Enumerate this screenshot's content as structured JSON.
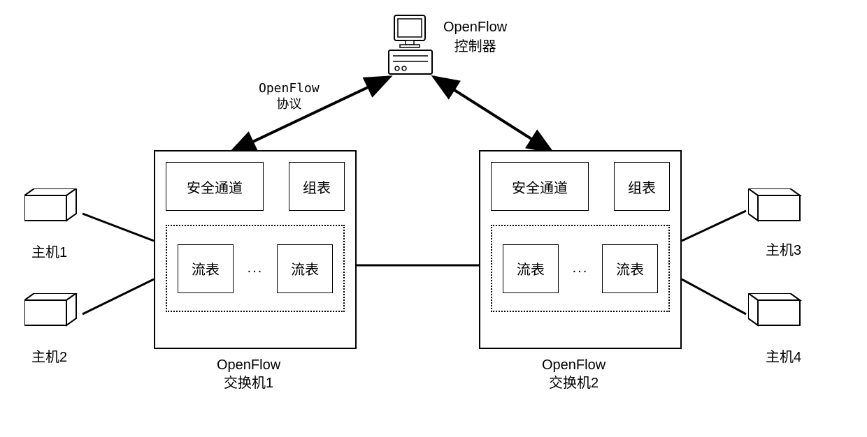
{
  "controller": {
    "title_line1": "OpenFlow",
    "title_line2": "控制器"
  },
  "protocol": {
    "line1": "OpenFlow",
    "line2": "协议"
  },
  "switches": [
    {
      "secure_channel": "安全通道",
      "group_table": "组表",
      "flow_table_1": "流表",
      "flow_table_2": "流表",
      "flow_dots": "...",
      "label_line1": "OpenFlow",
      "label_line2": "交换机1"
    },
    {
      "secure_channel": "安全通道",
      "group_table": "组表",
      "flow_table_1": "流表",
      "flow_table_2": "流表",
      "flow_dots": "...",
      "label_line1": "OpenFlow",
      "label_line2": "交换机2"
    }
  ],
  "hosts": [
    {
      "label": "主机1"
    },
    {
      "label": "主机2"
    },
    {
      "label": "主机3"
    },
    {
      "label": "主机4"
    }
  ]
}
